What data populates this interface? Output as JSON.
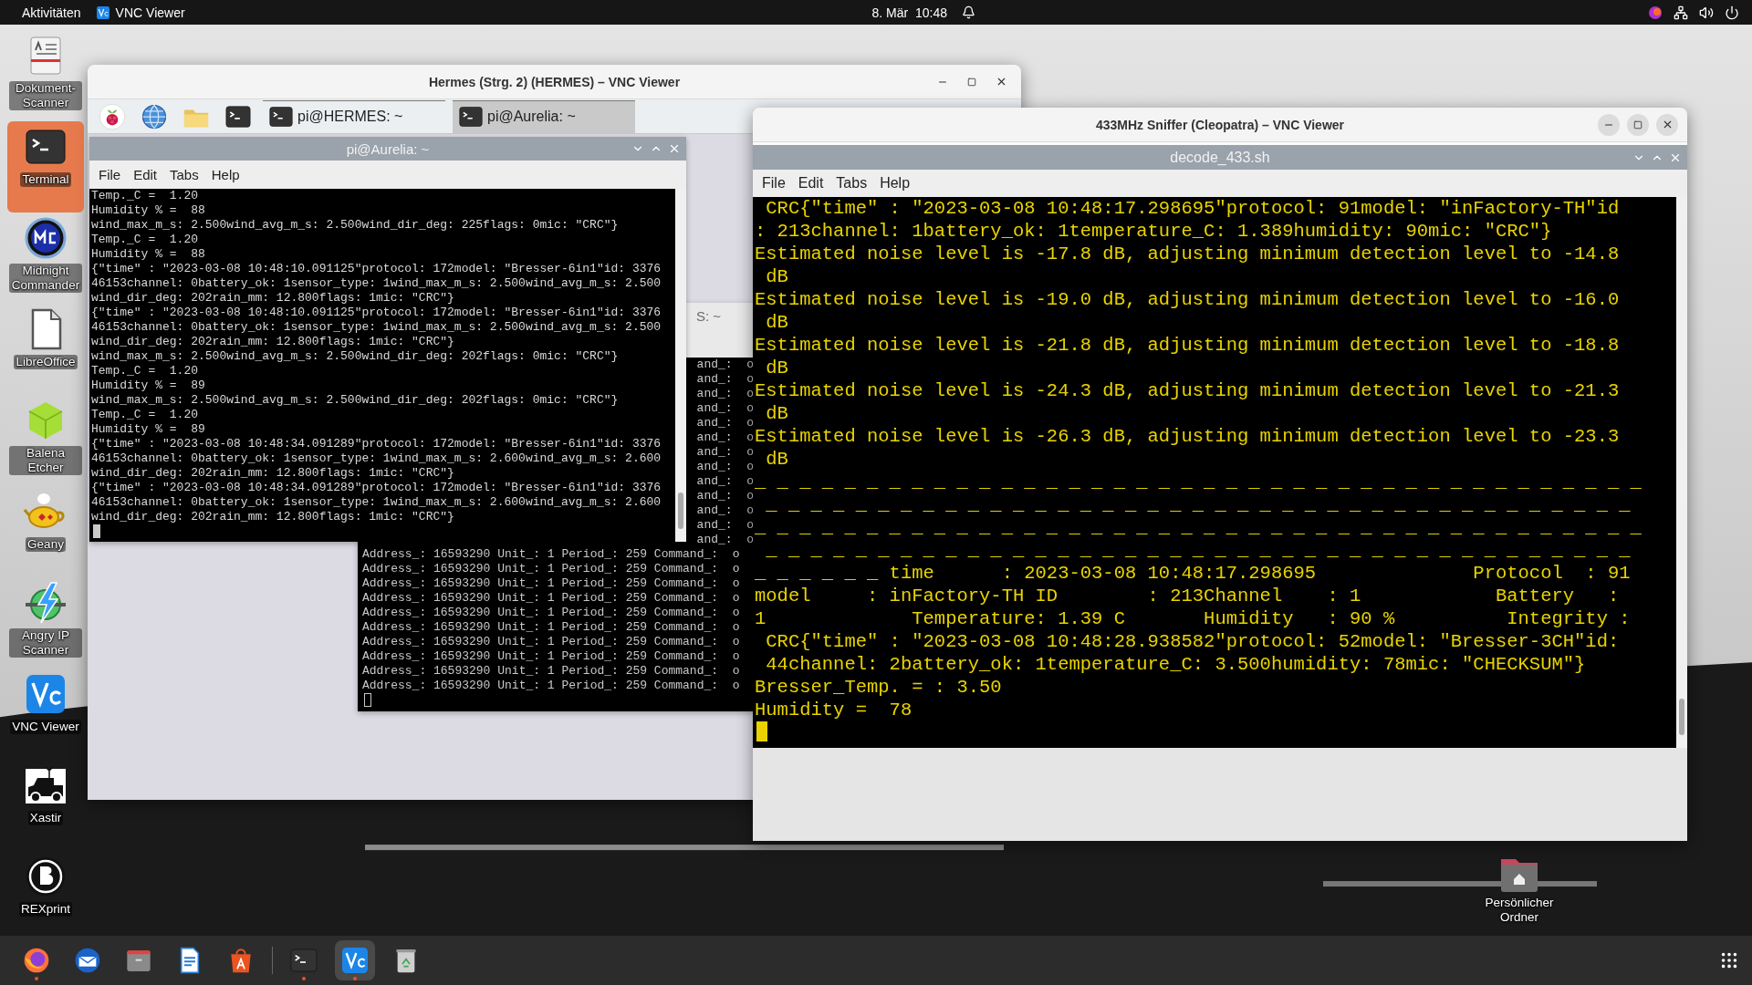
{
  "top_bar": {
    "activities": "Aktivitäten",
    "app_name": "VNC Viewer",
    "date": "8. Mär",
    "time": "10:48"
  },
  "desktop_icons": [
    {
      "label": "Dokument-Scanner",
      "kind": "scanner",
      "selected": false
    },
    {
      "label": "Terminal",
      "kind": "terminal",
      "selected": true
    },
    {
      "label": "Midnight Commander",
      "kind": "mc",
      "selected": false
    },
    {
      "label": "LibreOffice",
      "kind": "office",
      "selected": false
    },
    {
      "label": "Balena Etcher",
      "kind": "etcher",
      "selected": false
    },
    {
      "label": "Geany",
      "kind": "lamp",
      "selected": false
    },
    {
      "label": "Angry IP Scanner",
      "kind": "ipscan",
      "selected": false
    },
    {
      "label": "VNC Viewer",
      "kind": "vnc",
      "selected": false
    },
    {
      "label": "Xastir",
      "kind": "jeep",
      "selected": false
    },
    {
      "label": "REXprint",
      "kind": "rex",
      "selected": false
    }
  ],
  "home_folder": {
    "label": "Persönlicher Ordner"
  },
  "hermes_window": {
    "title": "Hermes (Strg. 2) (HERMES) – VNC Viewer",
    "launchers": [
      {
        "kind": "raspberry"
      },
      {
        "kind": "globe"
      },
      {
        "kind": "folder"
      },
      {
        "kind": "terminal"
      }
    ],
    "tasks": [
      {
        "label": "pi@HERMES: ~",
        "selected": false
      },
      {
        "label": "pi@Aurelia: ~",
        "selected": true
      }
    ],
    "terminal": {
      "title": "pi@Aurelia: ~",
      "menu": [
        "File",
        "Edit",
        "Tabs",
        "Help"
      ],
      "lines": [
        "Temp._C =  1.20",
        "Humidity % =  88",
        "wind_max_m_s: 2.500wind_avg_m_s: 2.500wind_dir_deg: 225flags: 0mic: \"CRC\"}",
        "Temp._C =  1.20",
        "Humidity % =  88",
        "{\"time\" : \"2023-03-08 10:48:10.091125\"protocol: 172model: \"Bresser-6in1\"id: 3376",
        "46153channel: 0battery_ok: 1sensor_type: 1wind_max_m_s: 2.500wind_avg_m_s: 2.500",
        "wind_dir_deg: 202rain_mm: 12.800flags: 1mic: \"CRC\"}",
        "{\"time\" : \"2023-03-08 10:48:10.091125\"protocol: 172model: \"Bresser-6in1\"id: 3376",
        "46153channel: 0battery_ok: 1sensor_type: 1wind_max_m_s: 2.500wind_avg_m_s: 2.500",
        "wind_dir_deg: 202rain_mm: 12.800flags: 1mic: \"CRC\"}",
        "wind_max_m_s: 2.500wind_avg_m_s: 2.500wind_dir_deg: 202flags: 0mic: \"CRC\"}",
        "Temp._C =  1.20",
        "Humidity % =  89",
        "wind_max_m_s: 2.500wind_avg_m_s: 2.500wind_dir_deg: 202flags: 0mic: \"CRC\"}",
        "Temp._C =  1.20",
        "Humidity % =  89",
        "{\"time\" : \"2023-03-08 10:48:34.091289\"protocol: 172model: \"Bresser-6in1\"id: 3376",
        "46153channel: 0battery_ok: 1sensor_type: 1wind_max_m_s: 2.600wind_avg_m_s: 2.600",
        "wind_dir_deg: 202rain_mm: 12.800flags: 1mic: \"CRC\"}",
        "{\"time\" : \"2023-03-08 10:48:34.091289\"protocol: 172model: \"Bresser-6in1\"id: 3376",
        "46153channel: 0battery_ok: 1sensor_type: 1wind_max_m_s: 2.600wind_avg_m_s: 2.600",
        "wind_dir_deg: 202rain_mm: 12.800flags: 1mic: \"CRC\"}"
      ]
    },
    "background_terminal": {
      "title": "S: ~",
      "covered_lines": [
        "and_:  o",
        "and_:  o",
        "and_:  o",
        "and_:  o",
        "and_:  o",
        "and_:  o",
        "and_:  o",
        "and_:  o",
        "and_:  o",
        "and_:  o",
        "and_:  o",
        "and_:  o",
        "and_:  o"
      ],
      "lines": [
        "Address_: 16593290 Unit_: 1 Period_: 259 Command_:  o",
        "Address_: 16593290 Unit_: 1 Period_: 259 Command_:  o",
        "Address_: 16593290 Unit_: 1 Period_: 259 Command_:  o",
        "Address_: 16593290 Unit_: 1 Period_: 259 Command_:  o",
        "Address_: 16593290 Unit_: 1 Period_: 259 Command_:  o",
        "Address_: 16593290 Unit_: 1 Period_: 259 Command_:  o",
        "Address_: 16593290 Unit_: 1 Period_: 259 Command_:  o",
        "Address_: 16593290 Unit_: 1 Period_: 259 Command_:  o",
        "Address_: 16593290 Unit_: 1 Period_: 259 Command_:  o",
        "Address_: 16593290 Unit_: 1 Period_: 259 Command_:  o"
      ]
    }
  },
  "sniffer_window": {
    "title": "433MHz Sniffer (Cleopatra) – VNC Viewer",
    "terminal": {
      "title": "decode_433.sh",
      "menu": [
        "File",
        "Edit",
        "Tabs",
        "Help"
      ],
      "lines": [
        " CRC{\"time\" : \"2023-03-08 10:48:17.298695\"protocol: 91model: \"inFactory-TH\"id",
        ": 213channel: 1battery_ok: 1temperature_C: 1.389humidity: 90mic: \"CRC\"}",
        "Estimated noise level is -17.8 dB, adjusting minimum detection level to -14.8",
        " dB",
        "Estimated noise level is -19.0 dB, adjusting minimum detection level to -16.0",
        " dB",
        "Estimated noise level is -21.8 dB, adjusting minimum detection level to -18.8",
        " dB",
        "Estimated noise level is -24.3 dB, adjusting minimum detection level to -21.3",
        " dB",
        "Estimated noise level is -26.3 dB, adjusting minimum detection level to -23.3",
        " dB",
        "_ _ _ _ _ _ _ _ _ _ _ _ _ _ _ _ _ _ _ _ _ _ _ _ _ _ _ _ _ _ _ _ _ _ _ _ _ _ _ _",
        " _ _ _ _ _ _ _ _ _ _ _ _ _ _ _ _ _ _ _ _ _ _ _ _ _ _ _ _ _ _ _ _ _ _ _ _ _ _ _",
        "_ _ _ _ _ _ _ _ _ _ _ _ _ _ _ _ _ _ _ _ _ _ _ _ _ _ _ _ _ _ _ _ _ _ _ _ _ _ _ _",
        " _ _ _ _ _ _ _ _ _ _ _ _ _ _ _ _ _ _ _ _ _ _ _ _ _ _ _ _ _ _ _ _ _ _ _ _ _ _ _",
        "_ _ _ _ _ _ time      : 2023-03-08 10:48:17.298695              Protocol  : 91",
        "model     : inFactory-TH ID        : 213Channel    : 1            Battery   :",
        "1             Temperature: 1.39 C       Humidity   : 90 %          Integrity :",
        " CRC{\"time\" : \"2023-03-08 10:48:28.938582\"protocol: 52model: \"Bresser-3CH\"id:",
        " 44channel: 2battery_ok: 1temperature_C: 3.500humidity: 78mic: \"CHECKSUM\"}",
        "Bresser_Temp. = : 3.50",
        "Humidity =  78"
      ]
    }
  },
  "dock": {
    "apps": [
      {
        "kind": "firefox",
        "running": true,
        "selected": false
      },
      {
        "kind": "mail",
        "running": false,
        "selected": false
      },
      {
        "kind": "files",
        "running": false,
        "selected": false
      },
      {
        "kind": "writer",
        "running": false,
        "selected": false
      },
      {
        "kind": "store",
        "running": false,
        "selected": false
      },
      {
        "kind": "terminal",
        "running": true,
        "selected": false
      },
      {
        "kind": "vnc",
        "running": true,
        "selected": true
      },
      {
        "kind": "trash",
        "running": false,
        "selected": false
      }
    ]
  }
}
